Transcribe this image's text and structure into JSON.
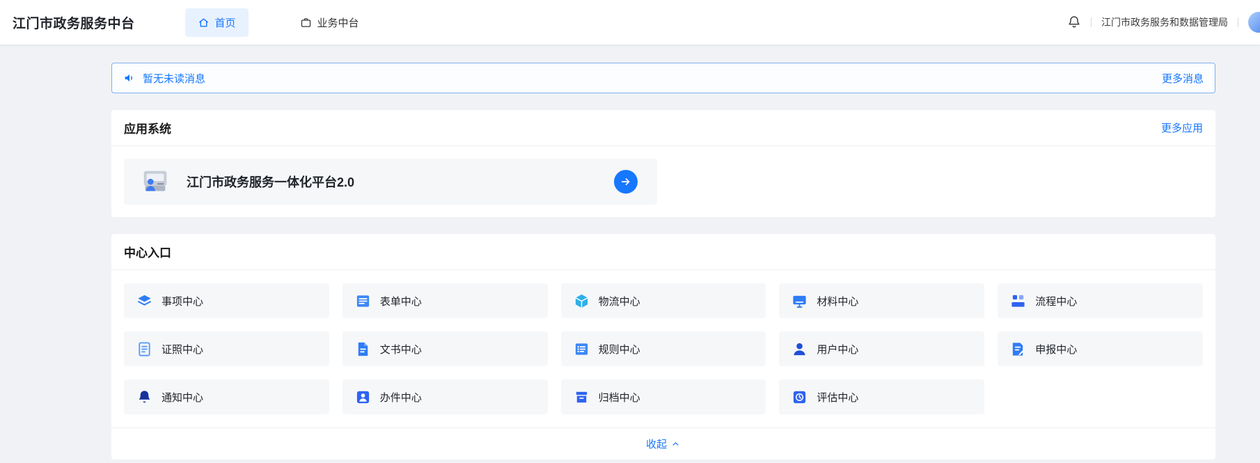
{
  "colors": {
    "primary": "#1677ff",
    "page_bg": "#f0f2f5",
    "banner_border": "#7fb0f2",
    "tile_bg": "#f6f7f9"
  },
  "header": {
    "title": "江门市政务服务中台",
    "tabs": [
      {
        "id": "home",
        "label": "首页",
        "icon": "home-icon",
        "active": true
      },
      {
        "id": "business",
        "label": "业务中台",
        "icon": "briefcase-icon",
        "active": false
      }
    ],
    "org_name": "江门市政务服务和数据管理局"
  },
  "notice_bar": {
    "message": "暂无未读消息",
    "more_label": "更多消息"
  },
  "app_section": {
    "title": "应用系统",
    "more_label": "更多应用",
    "apps": [
      {
        "name": "江门市政务服务一体化平台2.0",
        "icon": "platform-app-icon",
        "action_icon": "arrow-right-icon"
      }
    ]
  },
  "centers_section": {
    "title": "中心入口",
    "collapse_label": "收起",
    "items": [
      {
        "label": "事项中心",
        "icon": "matters-center-icon",
        "color": "#2f7cf6"
      },
      {
        "label": "表单中心",
        "icon": "form-center-icon",
        "color": "#3d87f5"
      },
      {
        "label": "物流中心",
        "icon": "logistics-center-icon",
        "color": "#2eb0e8"
      },
      {
        "label": "材料中心",
        "icon": "material-center-icon",
        "color": "#2f7cf6"
      },
      {
        "label": "流程中心",
        "icon": "process-center-icon",
        "color": "#2f63f0"
      },
      {
        "label": "证照中心",
        "icon": "license-center-icon",
        "color": "#5a9cf8"
      },
      {
        "label": "文书中心",
        "icon": "document-center-icon",
        "color": "#2f7cf6"
      },
      {
        "label": "规则中心",
        "icon": "rules-center-icon",
        "color": "#3d87f5"
      },
      {
        "label": "用户中心",
        "icon": "user-center-icon",
        "color": "#1e4fd6"
      },
      {
        "label": "申报中心",
        "icon": "declare-center-icon",
        "color": "#2f7cf6"
      },
      {
        "label": "通知中心",
        "icon": "notify-center-icon",
        "color": "#16339c"
      },
      {
        "label": "办件中心",
        "icon": "case-center-icon",
        "color": "#2f63f0"
      },
      {
        "label": "归档中心",
        "icon": "archive-center-icon",
        "color": "#2f63f0"
      },
      {
        "label": "评估中心",
        "icon": "evaluate-center-icon",
        "color": "#2f63f0"
      }
    ]
  }
}
